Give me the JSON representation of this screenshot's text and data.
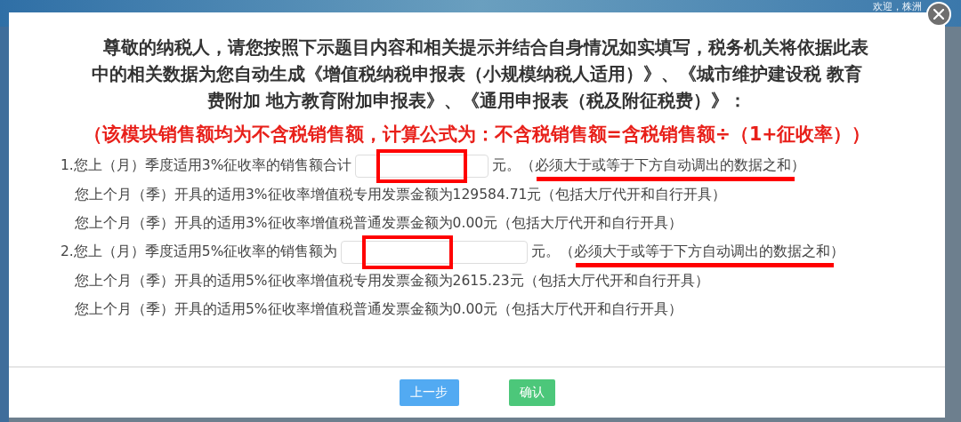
{
  "background": {
    "greeting": "欢迎，株洲"
  },
  "dialog": {
    "intro": "尊敬的纳税人，请您按照下示题目内容和相关提示并结合自身情况如实填写，税务机关将依据此表中的相关数据为您自动生成《增值税纳税申报表（小规模纳税人适用）》、《城市维护建设税 教育费附加 地方教育附加申报表》、《通用申报表（税及附征税费）》：",
    "formula_note": "（该模块销售额均为不含税销售额，计算公式为：不含税销售额=含税销售额÷（1+征收率））",
    "questions": [
      {
        "number": "1.",
        "label": "您上（月）季度适用3%征收率的销售额合计",
        "unit": "元。（",
        "hint": "必须大于或等于下方自动调出的数据之和",
        "hint_end": "）",
        "details": [
          "您上个月（季）开具的适用3%征收率增值税专用发票金额为129584.71元（包括大厅代开和自行开具）",
          "您上个月（季）开具的适用3%征收率增值税普通发票金额为0.00元（包括大厅代开和自行开具）"
        ]
      },
      {
        "number": "2.",
        "label": "您上（月）季度适用5%征收率的销售额为",
        "unit": "元。（",
        "hint": "必须大于或等于下方自动调出的数据之和",
        "hint_end": "）",
        "details": [
          "您上个月（季）开具的适用5%征收率增值税专用发票金额为2615.23元（包括大厅代开和自行开具）",
          "您上个月（季）开具的适用5%征收率增值税普通发票金额为0.00元（包括大厅代开和自行开具）"
        ]
      }
    ],
    "buttons": [
      {
        "label": "上一步",
        "kind": "secondary"
      },
      {
        "label": "确认",
        "kind": "primary"
      }
    ]
  }
}
